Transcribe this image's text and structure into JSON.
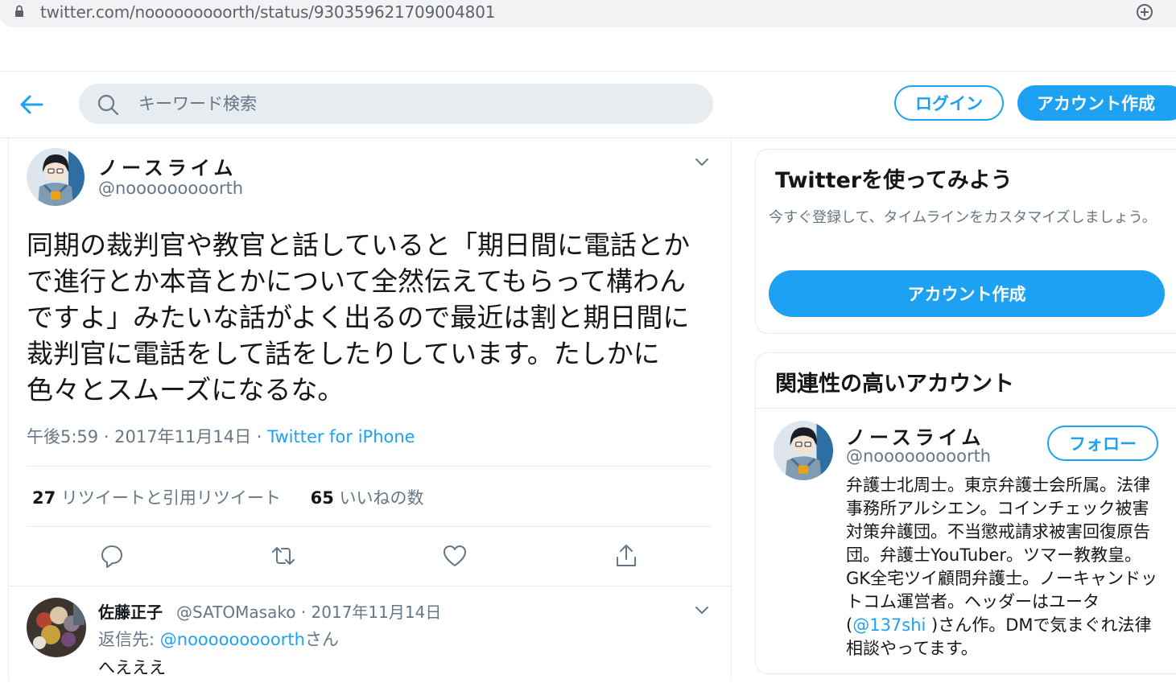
{
  "browser": {
    "url": "twitter.com/nooooooooorth/status/930359621709004801"
  },
  "header": {
    "search_placeholder": "キーワード検索",
    "login_label": "ログイン",
    "signup_label": "アカウント作成"
  },
  "tweet": {
    "author_name": "ノースライム",
    "author_handle": "@nooooooooorth",
    "text": "同期の裁判官や教官と話していると「期日間に電話とかで進行とか本音とかについて全然伝えてもらって構わんですよ」みたいな話がよく出るので最近は割と期日間に裁判官に電話をして話をしたりしています。たしかに色々とスムーズになるな。",
    "time": "午後5:59 · 2017年11月14日 · ",
    "source": "Twitter for iPhone",
    "retweet_count": "27",
    "retweet_label": " リツイートと引用リツイート",
    "like_count": "65",
    "like_label": " いいねの数"
  },
  "reply": {
    "name": "佐藤正子",
    "handle_date": "@SATOMasako · 2017年11月14日",
    "replying_prefix": "返信先: ",
    "replying_handle": "@nooooooooorth",
    "replying_suffix": "さん",
    "text": "へえええ"
  },
  "sidebar": {
    "signup_card": {
      "title": "Twitterを使ってみよう",
      "subtitle": "今すぐ登録して、タイムラインをカスタマイズしましょう。",
      "button": "アカウント作成"
    },
    "related": {
      "title": "関連性の高いアカウント",
      "name": "ノースライム",
      "handle": "@nooooooooorth",
      "follow_label": "フォロー",
      "bio_before": "弁護士北周士。東京弁護士会所属。法律事務所アルシエン。コインチェック被害対策弁護団。不当懲戒請求被害回復原告団。弁護士YouTuber。ツマー教教皇。GK全宅ツイ顧問弁護士。ノーキャンドットコム運営者。ヘッダーはユータ(",
      "bio_link": "@137shi",
      "bio_after": " )さん作。DMで気まぐれ法律相談やってます。"
    }
  },
  "colors": {
    "accent": "#1da1f2",
    "secondary_text": "#657786",
    "border": "#e6ecf0"
  }
}
